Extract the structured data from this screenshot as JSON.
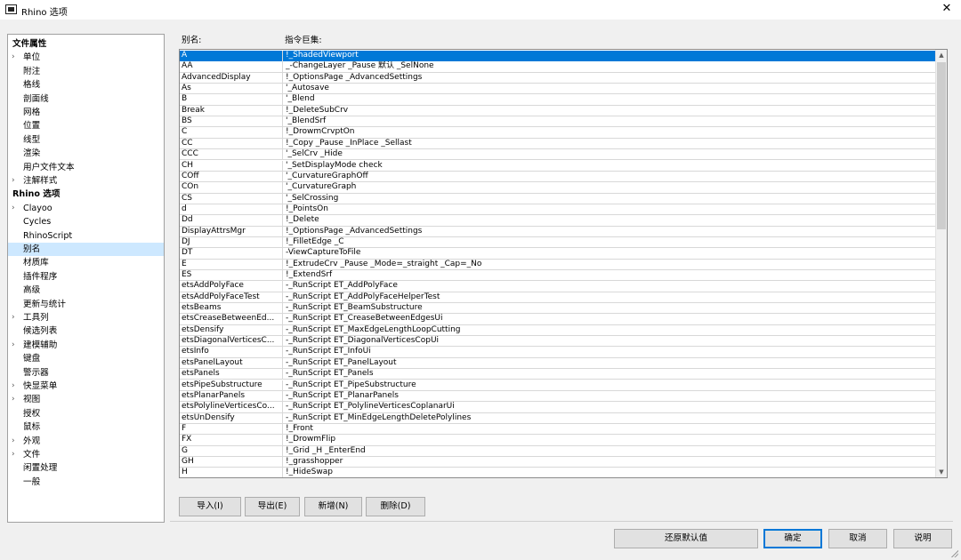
{
  "window": {
    "title": "Rhino 选项"
  },
  "tree": {
    "items": [
      {
        "label": "文件属性",
        "header": true,
        "expander": false,
        "indent": 0
      },
      {
        "label": "单位",
        "expander": true,
        "indent": 1
      },
      {
        "label": "附注",
        "expander": false,
        "indent": 1
      },
      {
        "label": "格线",
        "expander": false,
        "indent": 1
      },
      {
        "label": "剖面线",
        "expander": false,
        "indent": 1
      },
      {
        "label": "网格",
        "expander": false,
        "indent": 1
      },
      {
        "label": "位置",
        "expander": false,
        "indent": 1
      },
      {
        "label": "线型",
        "expander": false,
        "indent": 1
      },
      {
        "label": "渲染",
        "expander": false,
        "indent": 1
      },
      {
        "label": "用户文件文本",
        "expander": false,
        "indent": 1
      },
      {
        "label": "注解样式",
        "expander": true,
        "indent": 1
      },
      {
        "label": "Rhino 选项",
        "header": true,
        "expander": false,
        "indent": 0
      },
      {
        "label": "Clayoo",
        "expander": true,
        "indent": 1
      },
      {
        "label": "Cycles",
        "expander": false,
        "indent": 1
      },
      {
        "label": "RhinoScript",
        "expander": false,
        "indent": 1
      },
      {
        "label": "别名",
        "expander": false,
        "indent": 1,
        "selected": true
      },
      {
        "label": "材质库",
        "expander": false,
        "indent": 1
      },
      {
        "label": "插件程序",
        "expander": false,
        "indent": 1
      },
      {
        "label": "高级",
        "expander": false,
        "indent": 1
      },
      {
        "label": "更新与统计",
        "expander": false,
        "indent": 1
      },
      {
        "label": "工具列",
        "expander": true,
        "indent": 1
      },
      {
        "label": "候选列表",
        "expander": false,
        "indent": 1
      },
      {
        "label": "建模辅助",
        "expander": true,
        "indent": 1
      },
      {
        "label": "键盘",
        "expander": false,
        "indent": 1
      },
      {
        "label": "警示器",
        "expander": false,
        "indent": 1
      },
      {
        "label": "快显菜单",
        "expander": true,
        "indent": 1
      },
      {
        "label": "视图",
        "expander": true,
        "indent": 1
      },
      {
        "label": "授权",
        "expander": false,
        "indent": 1
      },
      {
        "label": "鼠标",
        "expander": false,
        "indent": 1
      },
      {
        "label": "外观",
        "expander": true,
        "indent": 1
      },
      {
        "label": "文件",
        "expander": true,
        "indent": 1
      },
      {
        "label": "闲置处理",
        "expander": false,
        "indent": 1
      },
      {
        "label": "一般",
        "expander": false,
        "indent": 1
      }
    ]
  },
  "columns": {
    "alias": "别名:",
    "macro": "指令巨集:"
  },
  "aliases": [
    [
      "A",
      "!_ShadedViewport"
    ],
    [
      "AA",
      "_-ChangeLayer _Pause  默认 _SelNone"
    ],
    [
      "AdvancedDisplay",
      "!_OptionsPage _AdvancedSettings"
    ],
    [
      "As",
      "'_Autosave"
    ],
    [
      "B",
      "'_Blend"
    ],
    [
      "Break",
      "!_DeleteSubCrv"
    ],
    [
      "BS",
      "'_BlendSrf"
    ],
    [
      "C",
      "!_DrowmCrvptOn"
    ],
    [
      "CC",
      "!_Copy _Pause _InPlace _Sellast"
    ],
    [
      "CCC",
      "'_SelCrv _Hide"
    ],
    [
      "CH",
      "'_SetDisplayMode check"
    ],
    [
      "COff",
      "'_CurvatureGraphOff"
    ],
    [
      "COn",
      "'_CurvatureGraph"
    ],
    [
      "CS",
      "'_SelCrossing"
    ],
    [
      "d",
      "!_PointsOn"
    ],
    [
      "Dd",
      "!_Delete"
    ],
    [
      "DisplayAttrsMgr",
      "!_OptionsPage _AdvancedSettings"
    ],
    [
      "DJ",
      "!_FilletEdge _C"
    ],
    [
      "DT",
      "-ViewCaptureToFile"
    ],
    [
      "E",
      "!_ExtrudeCrv _Pause _Mode=_straight _Cap=_No"
    ],
    [
      "ES",
      "!_ExtendSrf"
    ],
    [
      "etsAddPolyFace",
      "-_RunScript ET_AddPolyFace"
    ],
    [
      "etsAddPolyFaceTest",
      "-_RunScript ET_AddPolyFaceHelperTest"
    ],
    [
      "etsBeams",
      "-_RunScript ET_BeamSubstructure"
    ],
    [
      "etsCreaseBetweenEd...",
      "-_RunScript ET_CreaseBetweenEdgesUi"
    ],
    [
      "etsDensify",
      "-_RunScript ET_MaxEdgeLengthLoopCutting"
    ],
    [
      "etsDiagonalVerticesC...",
      "-_RunScript ET_DiagonalVerticesCopUi"
    ],
    [
      "etsInfo",
      "-_RunScript ET_InfoUi"
    ],
    [
      "etsPanelLayout",
      "-_RunScript ET_PanelLayout"
    ],
    [
      "etsPanels",
      "-_RunScript ET_Panels"
    ],
    [
      "etsPipeSubstructure",
      "-_RunScript ET_PipeSubstructure"
    ],
    [
      "etsPlanarPanels",
      "-_RunScript ET_PlanarPanels"
    ],
    [
      "etsPolylineVerticesCo...",
      "-_RunScript ET_PolylineVerticesCoplanarUi"
    ],
    [
      "etsUnDensify",
      "-_RunScript ET_MinEdgeLengthDeletePolylines"
    ],
    [
      "F",
      "!_Front"
    ],
    [
      "FX",
      "!_DrowmFlip"
    ],
    [
      "G",
      "!_Grid _H _EnterEnd"
    ],
    [
      "GH",
      "!_grasshopper"
    ],
    [
      "H",
      "!_HideSwap"
    ]
  ],
  "selected_row": 0,
  "buttons": {
    "import": "导入(I)",
    "export": "导出(E)",
    "new": "新增(N)",
    "delete": "删除(D)",
    "restore_defaults": "还原默认值",
    "ok": "确定",
    "cancel": "取消",
    "help": "说明"
  },
  "icons": {
    "close": "close-icon",
    "chevron": "chevron-right-icon",
    "scroll_up": "scroll-up-icon",
    "scroll_down": "scroll-down-icon"
  },
  "colors": {
    "selection": "#0078d7",
    "tree_selection": "#cde8ff"
  }
}
